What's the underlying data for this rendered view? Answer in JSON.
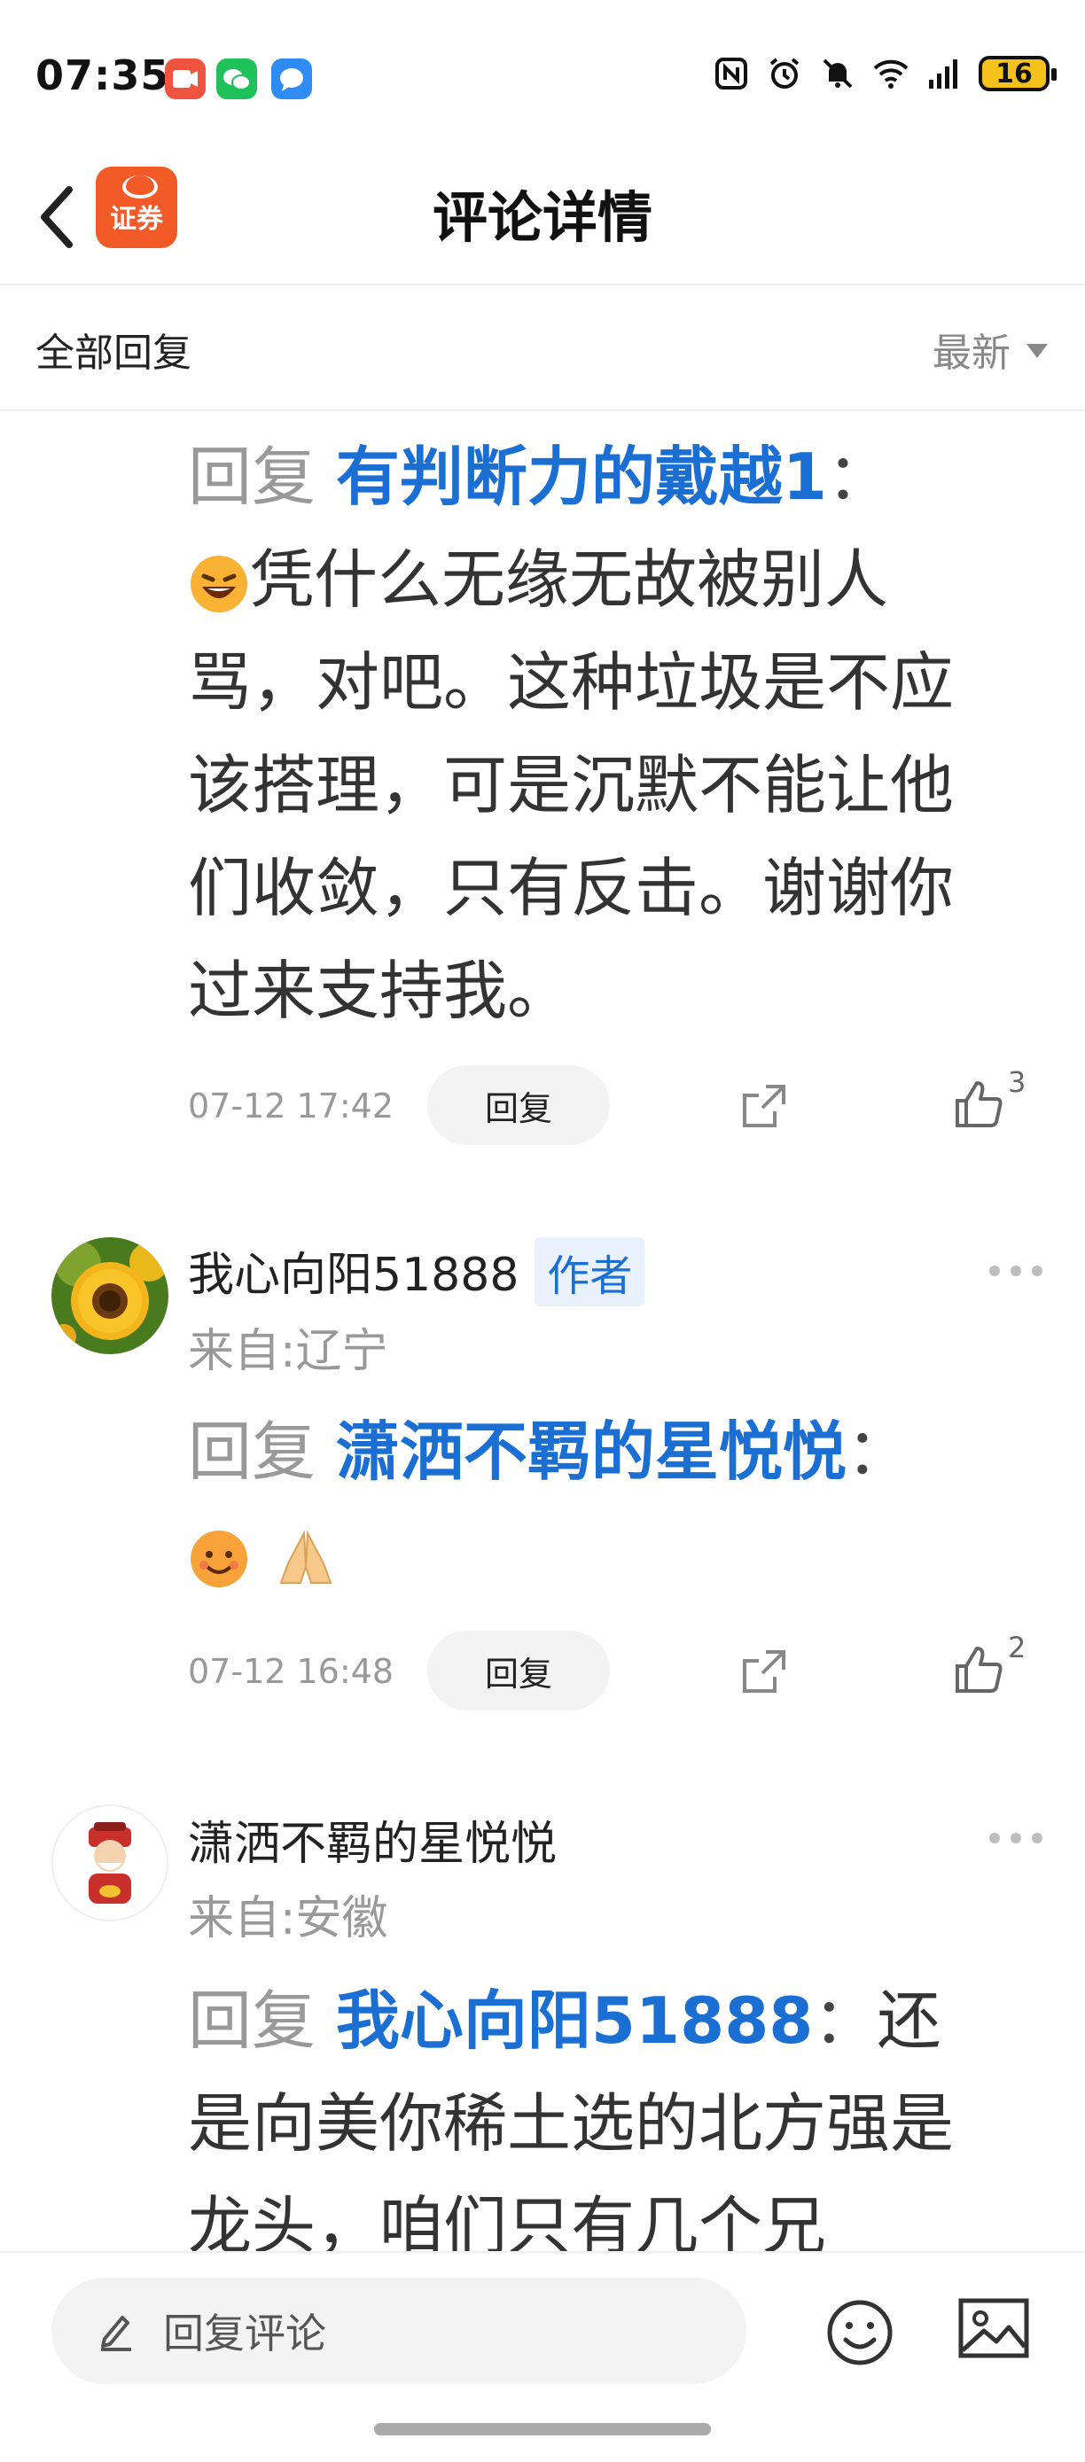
{
  "status_bar": {
    "time": "07:35",
    "battery_level": "16",
    "icons": [
      "nfc-icon",
      "alarm-icon",
      "mute-icon",
      "wifi-icon",
      "signal-icon",
      "battery-icon"
    ]
  },
  "header": {
    "title": "评论详情",
    "logo_text": "证券"
  },
  "filter": {
    "all_replies": "全部回复",
    "sort_label": "最新"
  },
  "comments": [
    {
      "reply_prefix": "回复",
      "reply_target": "有判断力的戴越1",
      "colon": "：",
      "text": "凭什么无缘无故被别人骂，对吧。这种垃圾是不应该搭理，可是沉默不能让他们收敛，只有反击。谢谢你过来支持我。",
      "time": "07-12 17:42",
      "reply_button": "回复",
      "likes": "3"
    },
    {
      "username": "我心向阳51888",
      "badge": "作者",
      "location": "来自:辽宁",
      "reply_prefix": "回复",
      "reply_target": "潇洒不羁的星悦悦",
      "colon": "：",
      "time": "07-12 16:48",
      "reply_button": "回复",
      "likes": "2"
    },
    {
      "username": "潇洒不羁的星悦悦",
      "location": "来自:安徽",
      "reply_prefix": "回复",
      "reply_target": "我心向阳51888",
      "colon": "：",
      "text": "还是向美你稀土选的北方强是龙头，咱们只有几个兄"
    }
  ],
  "bottom_bar": {
    "input_label": "回复评论"
  },
  "colors": {
    "accent_blue": "#1b6fd3",
    "brand_orange": "#f25a28",
    "muted_gray": "#999999"
  }
}
